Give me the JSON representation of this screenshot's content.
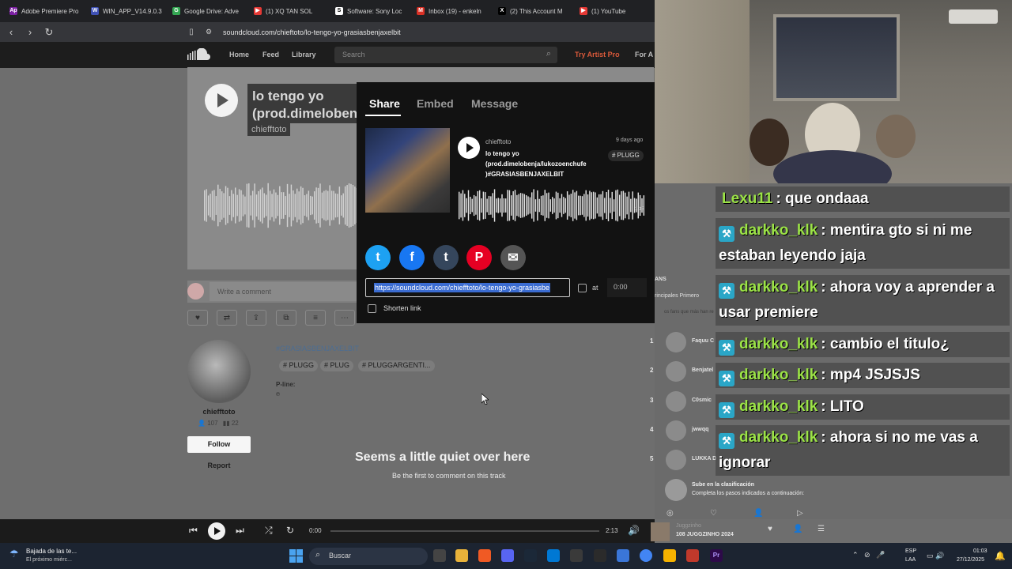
{
  "browser": {
    "tabs": [
      {
        "icon": "Ap",
        "color": "#7b1fa2",
        "label": "Adobe Premiere Pro"
      },
      {
        "icon": "W",
        "color": "#3f51b5",
        "label": "WIN_APP_V14.9.0.3"
      },
      {
        "icon": "G",
        "color": "#34a853",
        "label": "Google Drive: Adve"
      },
      {
        "icon": "▶",
        "color": "#e53935",
        "label": "(1) XQ TAN SOL"
      },
      {
        "icon": "S",
        "color": "#ffffff",
        "label": "Software: Sony Loc"
      },
      {
        "icon": "M",
        "color": "#d93025",
        "label": "Inbox (19) - enkeln"
      },
      {
        "icon": "X",
        "color": "#000000",
        "label": "(2) This Account M"
      },
      {
        "icon": "▶",
        "color": "#e53935",
        "label": "(1) YouTube"
      }
    ],
    "url": "soundcloud.com/chieftoto/lo-tengo-yo-grasiasbenjaxelbit"
  },
  "soundcloud": {
    "nav": {
      "home": "Home",
      "feed": "Feed",
      "library": "Library",
      "search_placeholder": "Search",
      "try_pro": "Try Artist Pro",
      "for_artists": "For A"
    },
    "hero": {
      "title": "lo tengo yo (prod.dimelobenja",
      "artist": "chiefftoto"
    },
    "comment_placeholder": "Write a comment",
    "artist": {
      "name": "chiefftoto",
      "followers": "107",
      "tracks": "22",
      "follow_label": "Follow",
      "report_label": "Report"
    },
    "description": {
      "hashtag": "#GRASIASBENJAXELBIT",
      "tags": [
        "# PLUGG",
        "# PLUG",
        "# PLUGGARGENTI..."
      ],
      "pline": "P-line:",
      "pline_symbol": "℗"
    },
    "empty_comments": {
      "title": "Seems a little quiet over here",
      "subtitle": "Be the first to comment on this track"
    },
    "fans": {
      "heading": "ANS",
      "tabs": "rincipales   Primero",
      "description": "os fans que más han re",
      "rows": [
        {
          "rank": "1",
          "name": "Faquu C"
        },
        {
          "rank": "2",
          "name": "Benjatel"
        },
        {
          "rank": "3",
          "name": "C0smic"
        },
        {
          "rank": "4",
          "name": "jwwqq"
        },
        {
          "rank": "5",
          "name": "LUKKA D"
        }
      ],
      "rank_up_title": "Sube en la clasificación",
      "rank_up_sub": "Completa los pasos indicados a continuación:"
    }
  },
  "share_modal": {
    "tabs": {
      "share": "Share",
      "embed": "Embed",
      "message": "Message"
    },
    "track": {
      "artist": "chiefftoto",
      "title": "lo tengo yo (prod.dimelobenja/lukozoenchufe )#GRASIASBENJAXELBIT",
      "date": "9 days ago",
      "tag": "# PLUGG",
      "duration": "1:38"
    },
    "social": [
      {
        "name": "twitter",
        "glyph": "t",
        "color": "#1da1f2"
      },
      {
        "name": "facebook",
        "glyph": "f",
        "color": "#1877f2"
      },
      {
        "name": "tumblr",
        "glyph": "t",
        "color": "#35465c"
      },
      {
        "name": "pinterest",
        "glyph": "P",
        "color": "#e60023"
      },
      {
        "name": "email",
        "glyph": "✉",
        "color": "#555555"
      }
    ],
    "url": "https://soundcloud.com/chiefftoto/lo-tengo-yo-grasiasbe",
    "at_label": "at",
    "time": "0:00",
    "shorten_label": "Shorten link"
  },
  "player": {
    "current": "0:00",
    "duration": "2:13",
    "user": "Juggzinho",
    "track": "108 JUGGZINHO 2024",
    "progress": 0
  },
  "chat": [
    {
      "user": "Lexu11",
      "text": ": que ondaaa",
      "badge": false
    },
    {
      "user": "darkko_klk",
      "text": ": mentira gto si ni me estaban leyendo jaja",
      "badge": true
    },
    {
      "user": "darkko_klk",
      "text": ": ahora voy a aprender a usar premiere",
      "badge": true
    },
    {
      "user": "darkko_klk",
      "text": ": cambio el titulo¿",
      "badge": true
    },
    {
      "user": "darkko_klk",
      "text": ": mp4 JSJSJS",
      "badge": true
    },
    {
      "user": "darkko_klk",
      "text": ": LITO",
      "badge": true
    },
    {
      "user": "darkko_klk",
      "text": ": ahora si no me vas a ignorar",
      "badge": true
    }
  ],
  "taskbar": {
    "weather_title": "Bajada de las te...",
    "weather_sub": "El próximo miérc...",
    "search": "Buscar",
    "lang1": "ESP",
    "lang2": "LAA",
    "time": "01:03",
    "date": "27/12/2025"
  }
}
